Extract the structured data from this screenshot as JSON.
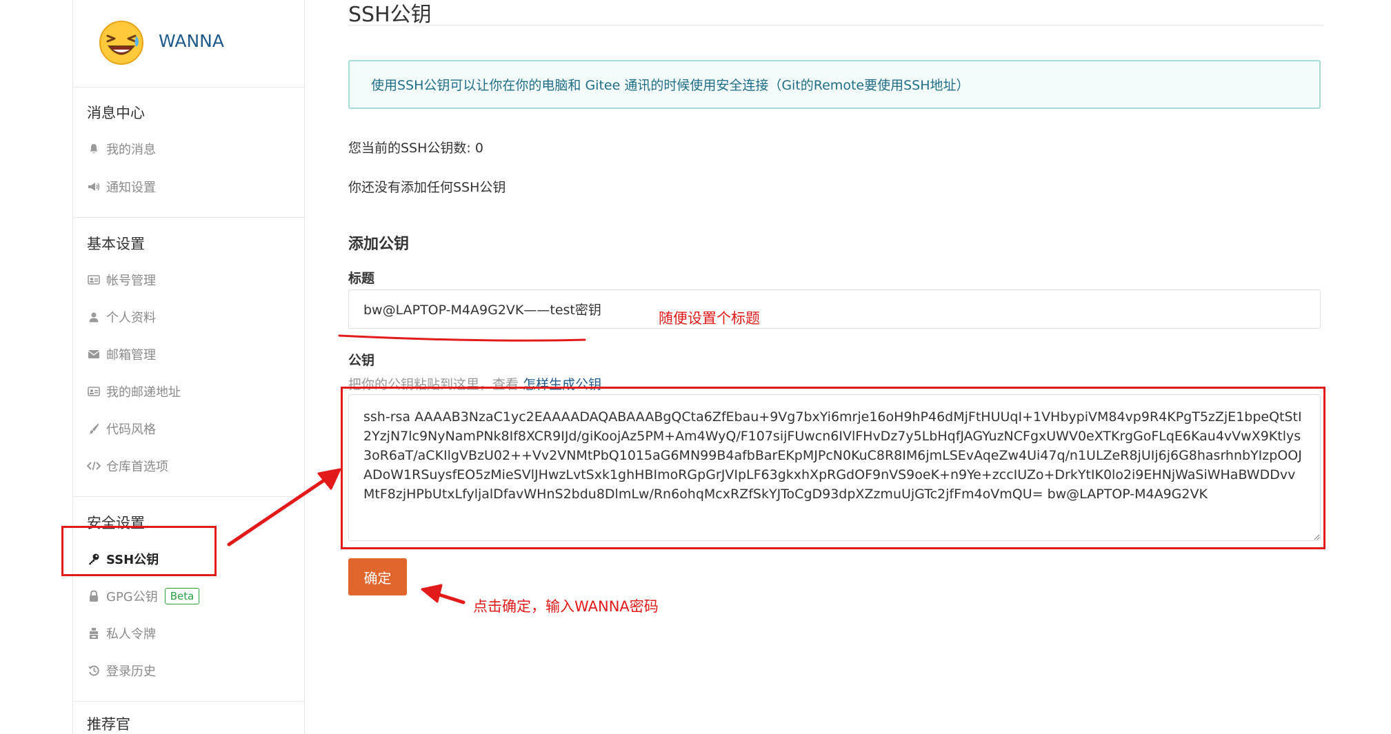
{
  "sidebar": {
    "username": "WANNA",
    "sections": [
      {
        "title": "消息中心",
        "items": [
          {
            "label": "我的消息",
            "icon": "bell-icon"
          },
          {
            "label": "通知设置",
            "icon": "megaphone-icon"
          }
        ]
      },
      {
        "title": "基本设置",
        "items": [
          {
            "label": "帐号管理",
            "icon": "id-card-icon"
          },
          {
            "label": "个人资料",
            "icon": "user-icon"
          },
          {
            "label": "邮箱管理",
            "icon": "envelope-icon"
          },
          {
            "label": "我的邮递地址",
            "icon": "address-card-icon"
          },
          {
            "label": "代码风格",
            "icon": "paintbrush-icon"
          },
          {
            "label": "仓库首选项",
            "icon": "code-icon"
          }
        ]
      },
      {
        "title": "安全设置",
        "items": [
          {
            "label": "SSH公钥",
            "icon": "key-icon",
            "active": true
          },
          {
            "label": "GPG公钥",
            "icon": "lock-icon",
            "badge": "Beta"
          },
          {
            "label": "私人令牌",
            "icon": "token-icon"
          },
          {
            "label": "登录历史",
            "icon": "history-icon"
          }
        ]
      },
      {
        "title": "推荐官",
        "items": []
      }
    ]
  },
  "main": {
    "page_title": "SSH公钥",
    "info_text": "使用SSH公钥可以让你在你的电脑和 Gitee 通讯的时候使用安全连接（Git的Remote要使用SSH地址）",
    "key_count": "您当前的SSH公钥数: 0",
    "no_keys": "你还没有添加任何SSH公钥",
    "add_heading": "添加公钥",
    "title_label": "标题",
    "title_value": "bw@LAPTOP-M4A9G2VK——test密钥",
    "key_label": "公钥",
    "key_hint": "把你的公钥粘贴到这里，查看",
    "key_hint_link": "怎样生成公钥",
    "key_value": "ssh-rsa AAAAB3NzaC1yc2EAAAADAQABAAABgQCta6ZfEbau+9Vg7bxYi6mrje16oH9hP46dMjFtHUUqI+1VHbypiVM84vp9R4KPgT5zZjE1bpeQtStI2YzjN7lc9NyNamPNk8If8XCR9IJd/giKoojAz5PM+Am4WyQ/F107sijFUwcn6IVlFHvDz7y5LbHqfJAGYuzNCFgxUWV0eXTKrgGoFLqE6Kau4vVwX9Ktlys3oR6aT/aCKIlgVBzU02++Vv2VNMtPbQ1015aG6MN99B4afbBarEKpMJPcN0KuC8R8IM6jmLSEvAqeZw4Ui47q/n1ULZeR8jUIj6j6G8hasrhnbYIzpOOJADoW1RSuysfEO5zMieSVlJHwzLvtSxk1ghHBImoRGpGrJVIpLF63gkxhXpRGdOF9nVS9oeK+n9Ye+zccIUZo+DrkYtIK0lo2i9EHNjWaSiWHaBWDDvvMtF8zjHPbUtxLfyljalDfavWHnS2bdu8DlmLw/Rn6ohqMcxRZfSkYJToCgD93dpXZzmuUjGTc2jfFm4oVmQU= bw@LAPTOP-M4A9G2VK",
    "submit_label": "确定"
  },
  "annotations": {
    "title_note": "随便设置个标题",
    "submit_note": "点击确定，输入WANNA密码",
    "color": "#e31a1a"
  }
}
